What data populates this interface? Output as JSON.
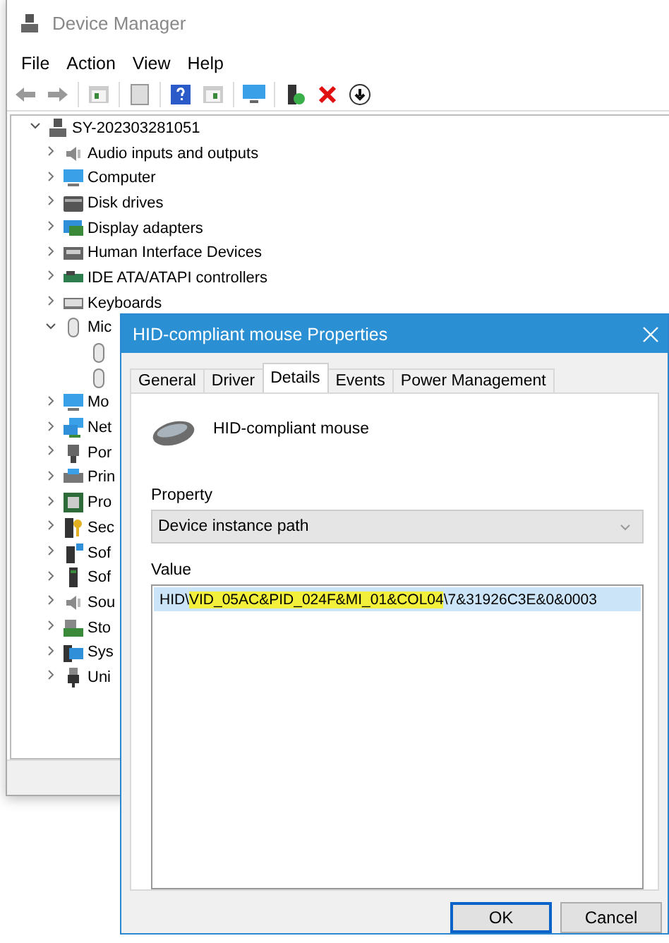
{
  "device_manager": {
    "title": "Device Manager",
    "menu": [
      "File",
      "Action",
      "View",
      "Help"
    ],
    "tree": {
      "label": "SY-202303281051",
      "expanded": true,
      "children": [
        {
          "label": "Audio inputs and outputs",
          "expanded": false
        },
        {
          "label": "Computer",
          "expanded": false
        },
        {
          "label": "Disk drives",
          "expanded": false
        },
        {
          "label": "Display adapters",
          "expanded": false
        },
        {
          "label": "Human Interface Devices",
          "expanded": false
        },
        {
          "label": "IDE ATA/ATAPI controllers",
          "expanded": false
        },
        {
          "label": "Keyboards",
          "expanded": false
        },
        {
          "label": "Mic",
          "expanded": true,
          "children": [
            {
              "kind": "device"
            },
            {
              "kind": "device"
            }
          ]
        },
        {
          "label": "Mo",
          "expanded": false
        },
        {
          "label": "Net",
          "expanded": false
        },
        {
          "label": "Por",
          "expanded": false
        },
        {
          "label": "Prin",
          "expanded": false
        },
        {
          "label": "Pro",
          "expanded": false
        },
        {
          "label": "Sec",
          "expanded": false
        },
        {
          "label": "Sof",
          "expanded": false
        },
        {
          "label": "Sof",
          "expanded": false
        },
        {
          "label": "Sou",
          "expanded": false
        },
        {
          "label": "Sto",
          "expanded": false
        },
        {
          "label": "Sys",
          "expanded": false
        },
        {
          "label": "Uni",
          "expanded": false
        }
      ]
    }
  },
  "dialog": {
    "title": "HID-compliant mouse Properties",
    "tabs": [
      {
        "label": "General",
        "selected": false
      },
      {
        "label": "Driver",
        "selected": false
      },
      {
        "label": "Details",
        "selected": true
      },
      {
        "label": "Events",
        "selected": false
      },
      {
        "label": "Power Management",
        "selected": false
      }
    ],
    "device_name": "HID-compliant mouse",
    "property_label": "Property",
    "property_value": "Device instance path",
    "value_label": "Value",
    "values": [
      {
        "selected": true,
        "segments": [
          {
            "text": "HID\\",
            "highlighted": false
          },
          {
            "text": "VID_05AC&PID_024F&MI_01&COL04",
            "highlighted": true
          },
          {
            "text": "\\7&31926C3E&0&0003",
            "highlighted": false
          }
        ]
      }
    ],
    "buttons": [
      {
        "label": "OK",
        "default": true
      },
      {
        "label": "Cancel",
        "default": false
      }
    ]
  }
}
